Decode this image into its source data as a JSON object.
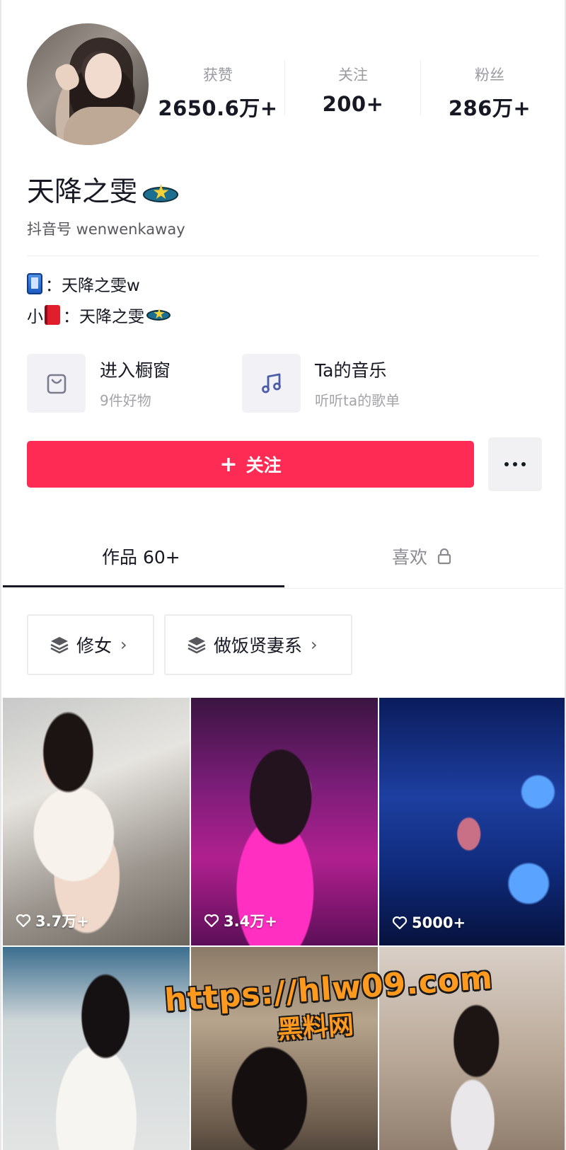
{
  "profile": {
    "name": "天降之雯",
    "douyin_id": "抖音号 wenwenkaway",
    "stats": [
      {
        "label": "获赞",
        "value": "2650.6万+"
      },
      {
        "label": "关注",
        "value": "200+"
      },
      {
        "label": "粉丝",
        "value": "286万+"
      }
    ],
    "bio": {
      "line1_sep": "：",
      "line1_text": "天降之雯w",
      "line2_prefix": "小",
      "line2_sep": "：",
      "line2_text": "天降之雯"
    }
  },
  "cards": [
    {
      "title": "进入橱窗",
      "subtitle": "9件好物",
      "icon": "shopping-bag-icon"
    },
    {
      "title": "Ta的音乐",
      "subtitle": "听听ta的歌单",
      "icon": "music-note-icon"
    }
  ],
  "actions": {
    "follow_plus": "+",
    "follow_label": "关注",
    "more_icon": "more-dots-icon"
  },
  "tabs": [
    {
      "label": "作品 60+",
      "active": true
    },
    {
      "label": "喜欢",
      "locked": true
    }
  ],
  "collections": [
    {
      "label": "修女",
      "icon": "layers-icon"
    },
    {
      "label": "做饭贤妻系",
      "icon": "layers-icon"
    }
  ],
  "videos": [
    {
      "likes": "3.7万+"
    },
    {
      "likes": "3.4万+"
    },
    {
      "likes": "5000+"
    },
    {
      "likes": ""
    },
    {
      "likes": ""
    },
    {
      "likes": ""
    }
  ],
  "watermark": {
    "url": "https://hlw09.com",
    "text": "黑料网"
  },
  "colors": {
    "accent": "#fe2c55",
    "text": "#161823",
    "muted": "#9a9ba1"
  }
}
